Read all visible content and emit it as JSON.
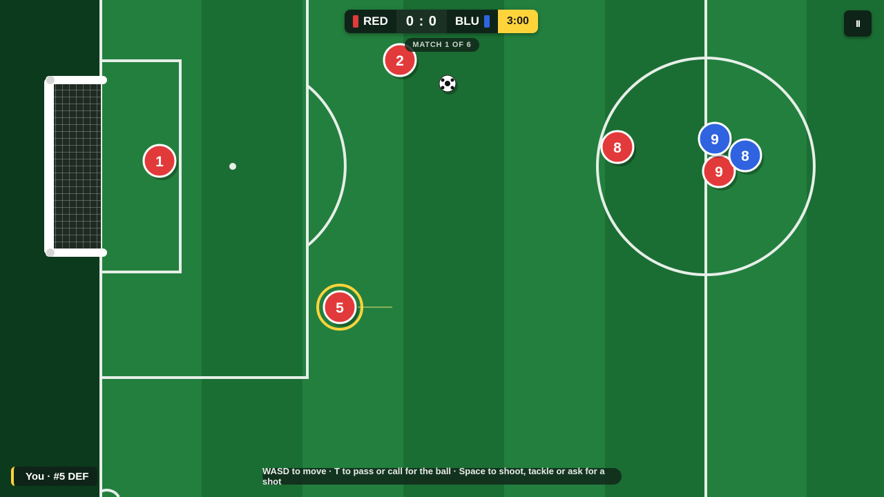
{
  "scoreboard": {
    "home_team": "RED",
    "away_team": "BLU",
    "score": "0 : 0",
    "timer": "3:00",
    "match_label": "MATCH 1 OF 6"
  },
  "pause_icon": "pause-icon",
  "pause_label": "II",
  "you_badge": "You · #5 DEF",
  "controls_hint": "WASD to move · T to pass or call for the ball · Space to shoot, tackle or ask for a shot",
  "colors": {
    "red_team": "#e23a3a",
    "blue_team": "#2f63e0",
    "selected_ring": "#ffd43b",
    "pitch_light": "#237f3e",
    "pitch_dark": "#1b6e33"
  },
  "players": [
    {
      "team": "red",
      "number": "1"
    },
    {
      "team": "red",
      "number": "2"
    },
    {
      "team": "red",
      "number": "5",
      "selected": true
    },
    {
      "team": "red",
      "number": "8"
    },
    {
      "team": "red",
      "number": "9"
    },
    {
      "team": "blue",
      "number": "9"
    },
    {
      "team": "blue",
      "number": "8"
    }
  ]
}
